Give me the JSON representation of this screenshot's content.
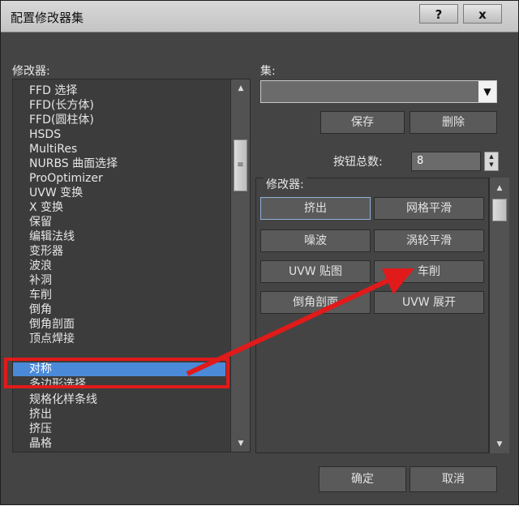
{
  "window": {
    "title": "配置修改器集",
    "help_label": "?",
    "close_label": "x"
  },
  "modifiers_panel": {
    "label": "修改器:",
    "items": [
      "FFD 选择",
      "FFD(长方体)",
      "FFD(圆柱体)",
      "HSDS",
      "MultiRes",
      "NURBS 曲面选择",
      "ProOptimizer",
      "UVW 变换",
      "X 变换",
      "保留",
      "编辑法线",
      "变形器",
      "波浪",
      "补洞",
      "车削",
      "倒角",
      "倒角剖面",
      "顶点焊接",
      "对称",
      "多边形选择",
      "规格化样条线",
      "挤出",
      "挤压",
      "晶格"
    ],
    "selected_item": "对称"
  },
  "set_panel": {
    "label": "集:",
    "dropdown_value": "",
    "save_label": "保存",
    "delete_label": "删除",
    "button_count_label": "按钮总数:",
    "button_count_value": "8"
  },
  "modifier_buttons": {
    "label": "修改器:",
    "buttons": [
      "挤出",
      "网格平滑",
      "噪波",
      "涡轮平滑",
      "UVW 贴图",
      "车削",
      "倒角剖面",
      "UVW 展开"
    ]
  },
  "footer": {
    "ok_label": "确定",
    "cancel_label": "取消"
  },
  "colors": {
    "selection": "#4a8ad8",
    "annotation": "#e11a1a"
  }
}
